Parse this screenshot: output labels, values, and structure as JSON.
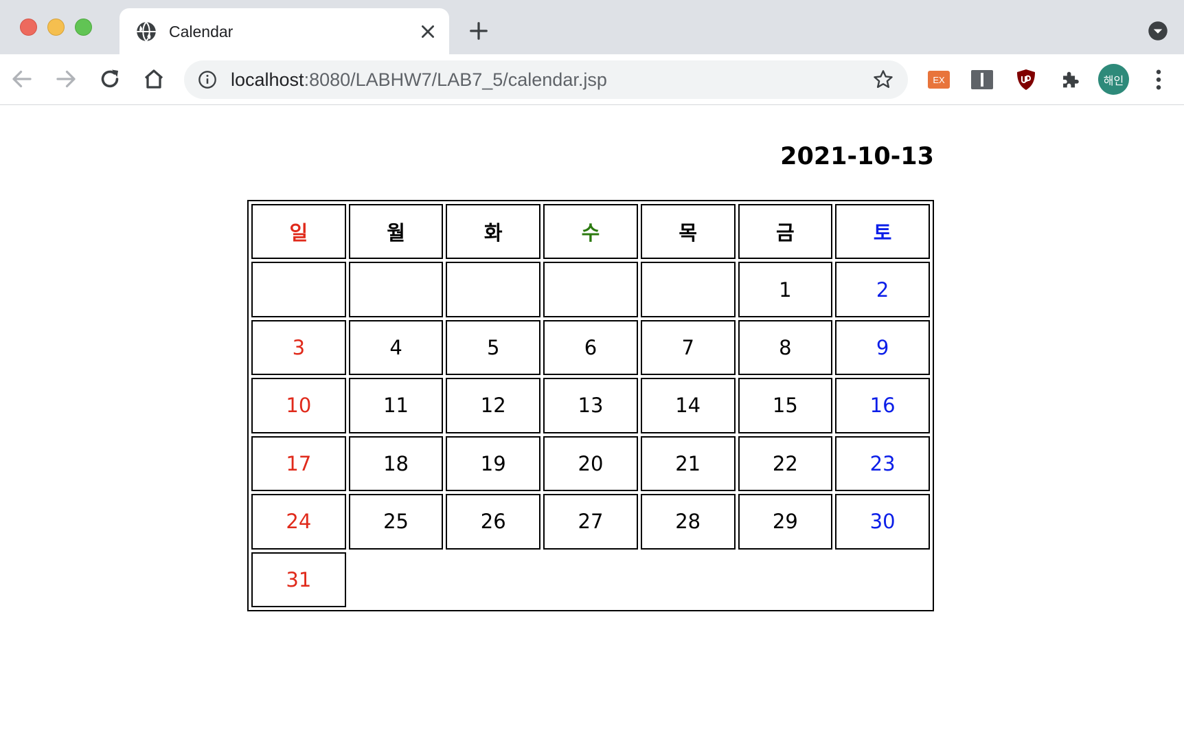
{
  "browser": {
    "tab_title": "Calendar",
    "url_host": "localhost",
    "url_path": ":8080/LABHW7/LAB7_5/calendar.jsp",
    "avatar_text": "해인",
    "ext_badge": "EX"
  },
  "page": {
    "date": "2021-10-13",
    "weekdays": [
      "일",
      "월",
      "화",
      "수",
      "목",
      "금",
      "토"
    ],
    "weeks": [
      [
        "",
        "",
        "",
        "",
        "",
        "1",
        "2"
      ],
      [
        "3",
        "4",
        "5",
        "6",
        "7",
        "8",
        "9"
      ],
      [
        "10",
        "11",
        "12",
        "13",
        "14",
        "15",
        "16"
      ],
      [
        "17",
        "18",
        "19",
        "20",
        "21",
        "22",
        "23"
      ],
      [
        "24",
        "25",
        "26",
        "27",
        "28",
        "29",
        "30"
      ],
      [
        "31",
        "",
        "",
        "",
        "",
        "",
        ""
      ]
    ]
  },
  "colors": {
    "sunday": "#e02a1b",
    "saturday": "#0b1ee8",
    "wednesday_header": "#2c7a10"
  }
}
